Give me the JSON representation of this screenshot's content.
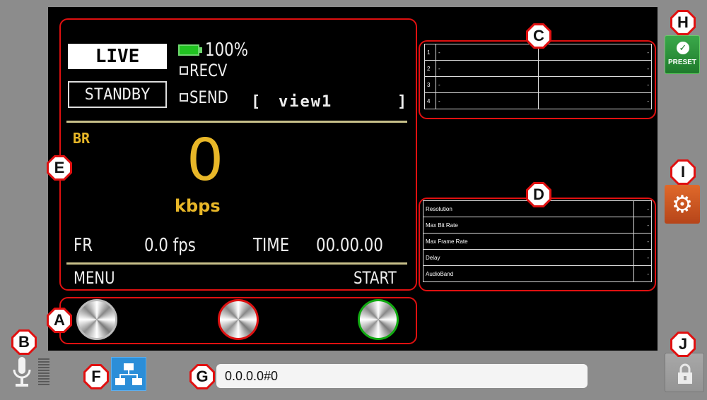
{
  "status": {
    "live_label": "LIVE",
    "standby_label": "STANDBY",
    "battery": "100%",
    "recv_label": "RECV",
    "send_label": "SEND",
    "view_open": "[",
    "view_name": "view1",
    "view_close": "]"
  },
  "bitrate": {
    "label": "BR",
    "value": "0",
    "unit": "kbps"
  },
  "frame": {
    "fr_label": "FR",
    "fr_value": "0.0 fps",
    "time_label": "TIME",
    "time_value": "00.00.00"
  },
  "footer": {
    "menu_label": "MENU",
    "start_label": "START"
  },
  "preset_table": [
    {
      "num": "1",
      "name": "-",
      "value": "-"
    },
    {
      "num": "2",
      "name": "-",
      "value": "-"
    },
    {
      "num": "3",
      "name": "-",
      "value": "-"
    },
    {
      "num": "4",
      "name": "-",
      "value": "-"
    }
  ],
  "info_table": [
    {
      "label": "Resolution",
      "value": "-"
    },
    {
      "label": "Max Bit Rate",
      "value": "-"
    },
    {
      "label": "Max Frame Rate",
      "value": "-"
    },
    {
      "label": "Delay",
      "value": "-"
    },
    {
      "label": "AudioBand",
      "value": "-"
    }
  ],
  "buttons": {
    "preset_label": "PRESET",
    "preset_icon": "check-icon",
    "settings_icon": "gear-icon",
    "lock_icon": "lock-icon",
    "network_icon": "network-icon",
    "mic_icon": "microphone-icon"
  },
  "address": "0.0.0.0#0",
  "badges": {
    "a": "A",
    "b": "B",
    "c": "C",
    "d": "D",
    "e": "E",
    "f": "F",
    "g": "G",
    "h": "H",
    "i": "I",
    "j": "J"
  },
  "colors": {
    "callout": "#e01010",
    "accent_yellow": "#e8b728",
    "preset_green": "#2e9a3e",
    "settings_orange": "#d35a22",
    "network_blue": "#2b8ed8"
  }
}
